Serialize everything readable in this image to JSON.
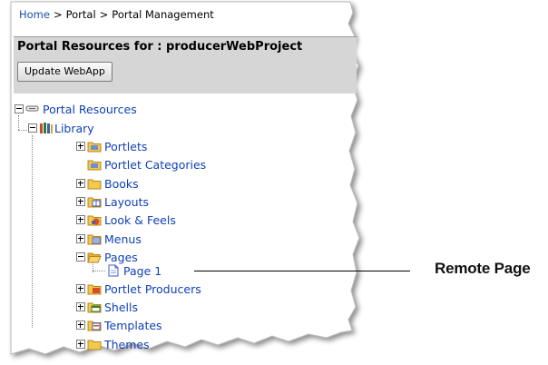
{
  "breadcrumb": {
    "home": "Home",
    "sep1": ">",
    "portal": "Portal",
    "sep2": ">",
    "current": "Portal Management"
  },
  "header": {
    "title": "Portal Resources for : producerWebProject",
    "update_button": "Update WebApp"
  },
  "tree": {
    "root": "Portal Resources",
    "library": "Library",
    "portlets": "Portlets",
    "portlet_categories": "Portlet Categories",
    "books": "Books",
    "layouts": "Layouts",
    "look_feels": "Look & Feels",
    "menus": "Menus",
    "pages": "Pages",
    "page1": "Page 1",
    "portlet_producers": "Portlet Producers",
    "shells": "Shells",
    "templates": "Templates",
    "themes": "Themes"
  },
  "callout": {
    "label": "Remote Page"
  },
  "colors": {
    "link": "#1040b8",
    "header_bg": "#d6d6d6",
    "folder": "#f2c94c"
  }
}
